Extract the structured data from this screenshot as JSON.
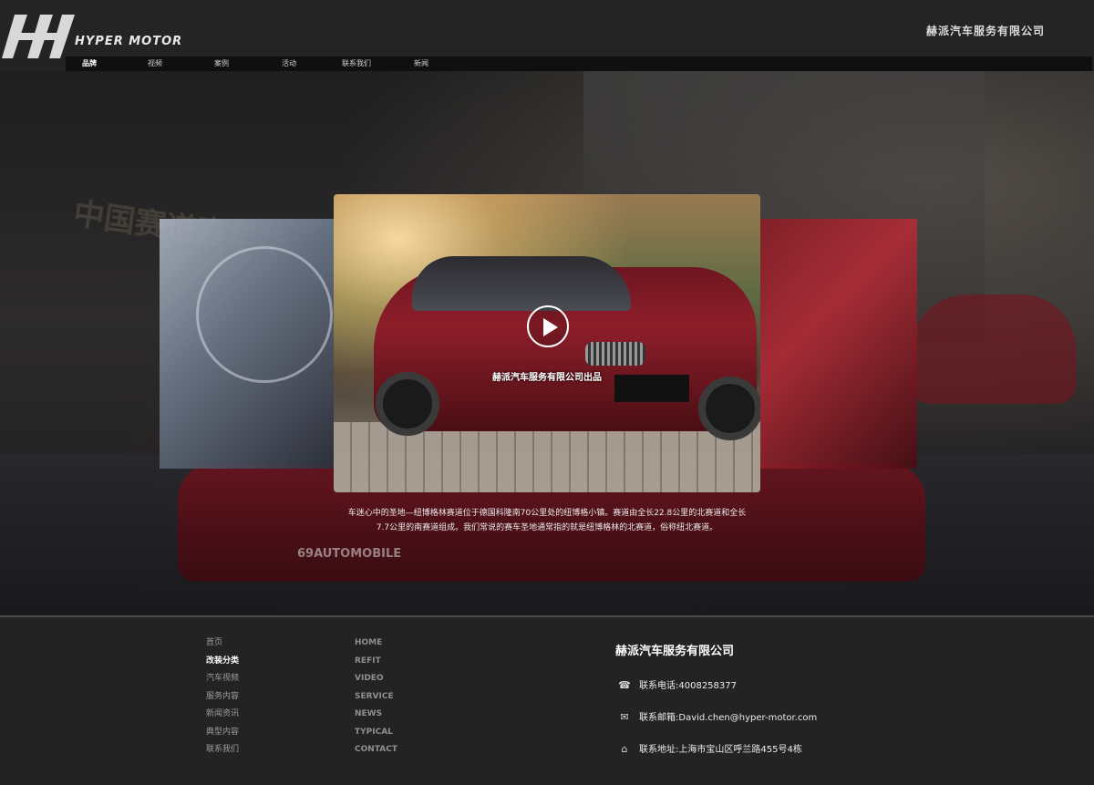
{
  "header": {
    "logo_text": "Hyper Motor",
    "company": "赫派汽车服务有限公司"
  },
  "nav": {
    "items": [
      {
        "label": "品牌",
        "active": true
      },
      {
        "label": "视频"
      },
      {
        "label": "案例"
      },
      {
        "label": "活动"
      },
      {
        "label": "联系我们"
      },
      {
        "label": "新闻"
      }
    ]
  },
  "hero": {
    "background_text": "中国赛道嘉年华",
    "background_brand": "69AUTOMOBILE",
    "slide_caption": "赫派汽车服务有限公司出品",
    "description_line1": "车迷心中的圣地—纽博格林赛道位于德国科隆南70公里处的纽博格小镇。赛道由全长22.8公里的北赛道和全长",
    "description_line2": "7.7公里的南赛道组成。我们常说的赛车圣地通常指的就是纽博格林的北赛道，俗称纽北赛道。"
  },
  "footer": {
    "cn_links": [
      {
        "label": "首页"
      },
      {
        "label": "改装分类",
        "active": true
      },
      {
        "label": "汽车视频"
      },
      {
        "label": "服务内容"
      },
      {
        "label": "新闻资讯"
      },
      {
        "label": "典型内容"
      },
      {
        "label": "联系我们"
      }
    ],
    "en_links": [
      "HOME",
      "REFIT",
      "VIDEO",
      "SERVICE",
      "NEWS",
      "TYPICAL",
      "CONTACT"
    ],
    "company": "赫派汽车服务有限公司",
    "phone": "联系电话:4008258377",
    "email": "联系邮箱:David.chen@hyper-motor.com",
    "address": "联系地址:上海市宝山区呼兰路455号4栋"
  },
  "icons": {
    "phone": "phone-icon",
    "email": "mail-icon",
    "address": "home-icon",
    "play": "play-icon"
  }
}
